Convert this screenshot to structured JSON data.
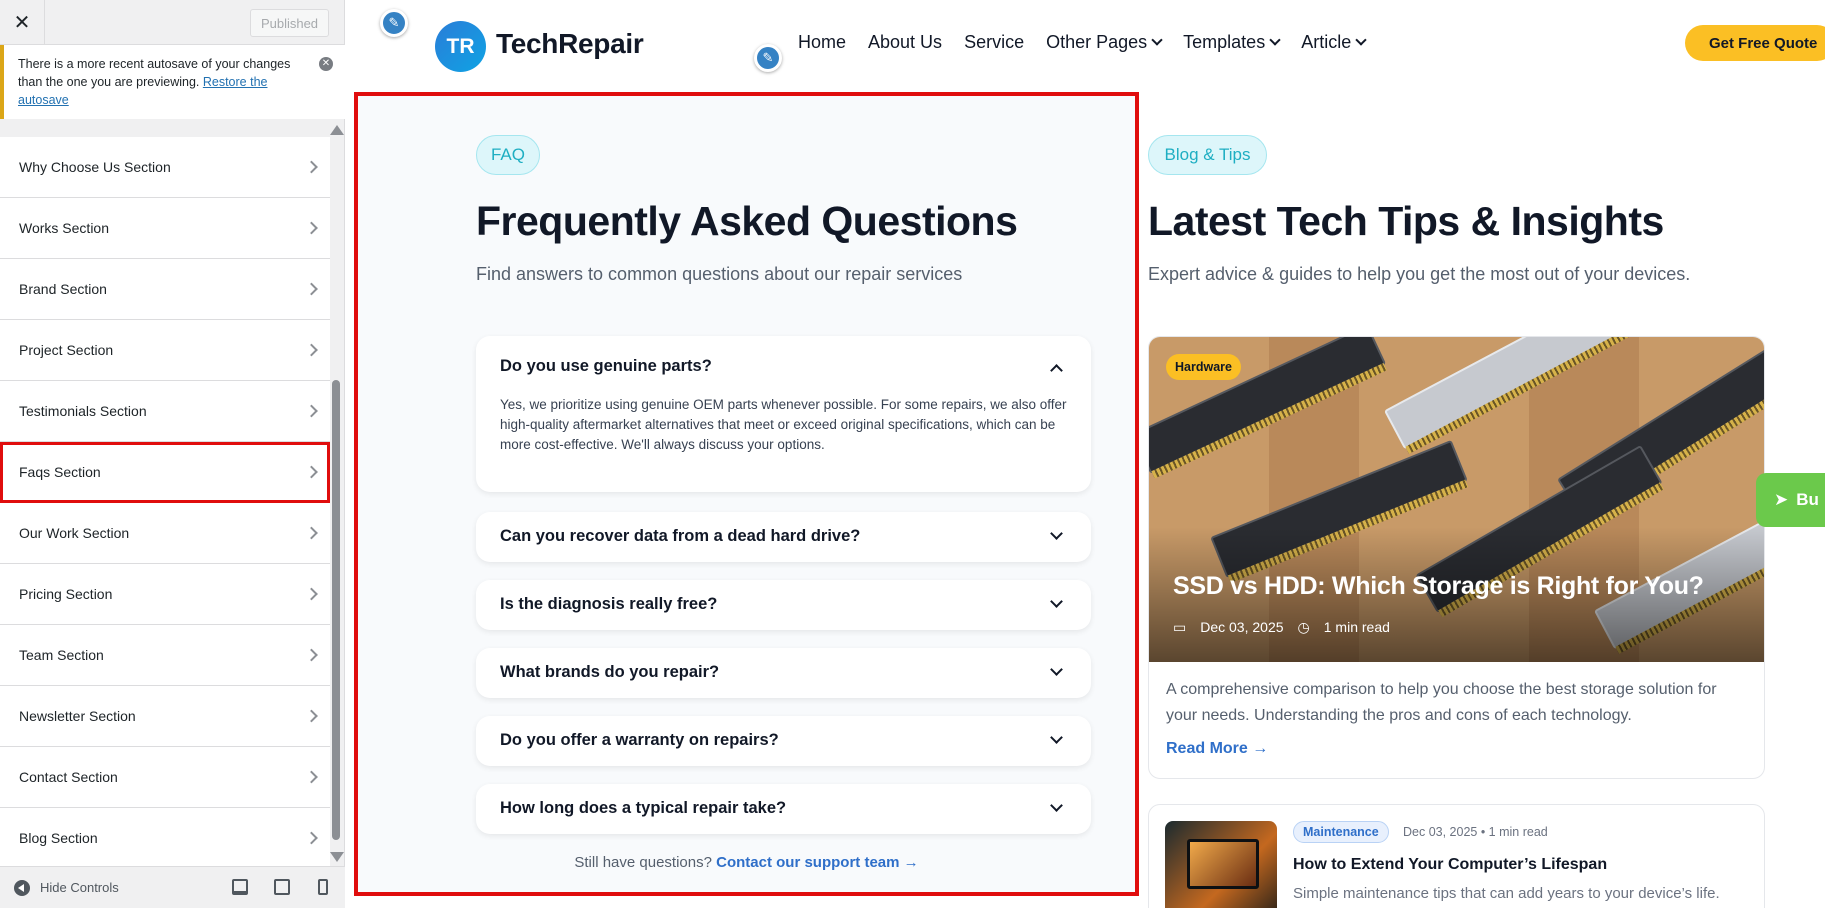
{
  "sidebar": {
    "close_glyph": "✕",
    "publish_label": "Published",
    "notice": {
      "text": "There is a more recent autosave of your changes than the one you are previewing.",
      "link": "Restore the autosave"
    },
    "items": [
      {
        "label": "Why Choose Us Section"
      },
      {
        "label": "Works Section"
      },
      {
        "label": "Brand Section"
      },
      {
        "label": "Project Section"
      },
      {
        "label": "Testimonials Section"
      },
      {
        "label": "Faqs Section"
      },
      {
        "label": "Our Work Section"
      },
      {
        "label": "Pricing Section"
      },
      {
        "label": "Team Section"
      },
      {
        "label": "Newsletter Section"
      },
      {
        "label": "Contact Section"
      },
      {
        "label": "Blog Section"
      }
    ],
    "highlighted_item": "Faqs Section",
    "hide_controls_label": "Hide Controls",
    "highlight_color": "#e00d0d"
  },
  "header": {
    "logo_initials": "TR",
    "logo_text": "TechRepair",
    "nav": [
      {
        "label": "Home",
        "dropdown": false
      },
      {
        "label": "About Us",
        "dropdown": false
      },
      {
        "label": "Service",
        "dropdown": false
      },
      {
        "label": "Other Pages",
        "dropdown": true
      },
      {
        "label": "Templates",
        "dropdown": true
      },
      {
        "label": "Article",
        "dropdown": true
      }
    ],
    "cta_label": "Get Free Quote",
    "cta_color": "#fbbf24"
  },
  "faq": {
    "tag": "FAQ",
    "title": "Frequently Asked Questions",
    "subtitle": "Find answers to common questions about our repair services",
    "items": [
      {
        "q": "Do you use genuine parts?",
        "open": true,
        "a": "Yes, we prioritize using genuine OEM parts whenever possible. For some repairs, we also offer high-quality aftermarket alternatives that meet or exceed original specifications, which can be more cost-effective. We'll always discuss your options."
      },
      {
        "q": "Can you recover data from a dead hard drive?",
        "open": false
      },
      {
        "q": "Is the diagnosis really free?",
        "open": false
      },
      {
        "q": "What brands do you repair?",
        "open": false
      },
      {
        "q": "Do you offer a warranty on repairs?",
        "open": false
      },
      {
        "q": "How long does a typical repair take?",
        "open": false
      }
    ],
    "still_text": "Still have questions?",
    "still_link": "Contact our support team →"
  },
  "blog": {
    "tag": "Blog & Tips",
    "title": "Latest Tech Tips & Insights",
    "subtitle": "Expert advice & guides to help you get the most out of your devices.",
    "featured": {
      "category": "Hardware",
      "title": "SSD vs HDD: Which Storage is Right for You?",
      "date": "Dec 03, 2025",
      "read_time": "1 min read",
      "excerpt": "A comprehensive comparison to help you choose the best storage solution for your needs. Understanding the pros and cons of each technology.",
      "read_more": "Read More →"
    },
    "second": {
      "category": "Maintenance",
      "meta": "Dec 03, 2025 • 1 min read",
      "title": "How to Extend Your Computer’s Lifespan",
      "excerpt": "Simple maintenance tips that can add years to your device’s life."
    },
    "buy_label": "Bu"
  }
}
